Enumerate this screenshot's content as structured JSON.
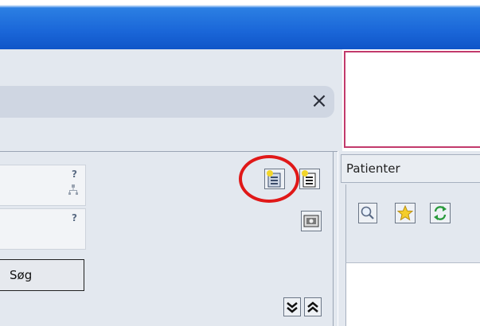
{
  "titlebar": {
    "color": "#1a66d8"
  },
  "search": {
    "clear_icon": "×"
  },
  "fields": [
    {
      "help": "?",
      "icon": "hierarchy-icon"
    },
    {
      "help": "?"
    }
  ],
  "buttons": {
    "search_label": "Søg",
    "new_document_icon": "new-document-icon",
    "new_document_alt_icon": "new-document-alt-icon",
    "image_icon": "image-icon",
    "expand_icon": "expand-down-icon",
    "collapse_icon": "collapse-up-icon"
  },
  "patients": {
    "header": "Patienter",
    "toolbar": [
      "search-icon",
      "star-icon",
      "refresh-icon"
    ]
  },
  "accents": {
    "highlight": "#e01818",
    "border_pink": "#c23a6c"
  }
}
